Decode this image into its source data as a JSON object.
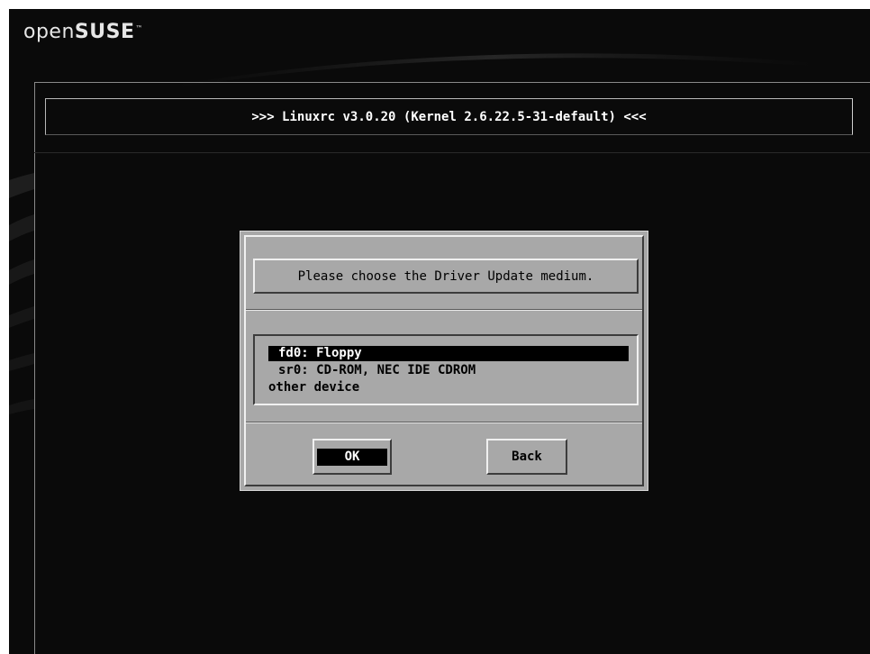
{
  "branding": {
    "logo_open": "open",
    "logo_suse": "SUSE",
    "logo_tm": "™"
  },
  "title_bar": {
    "text": ">>> Linuxrc v3.0.20 (Kernel 2.6.22.5-31-default) <<<"
  },
  "dialog": {
    "prompt": "Please choose the Driver Update medium.",
    "items": [
      {
        "label": "fd0: Floppy",
        "selected": true
      },
      {
        "label": "sr0: CD-ROM, NEC IDE CDROM",
        "selected": false
      },
      {
        "label": "other device",
        "selected": false
      }
    ],
    "buttons": {
      "ok": "OK",
      "back": "Back"
    }
  },
  "colors": {
    "screen_bg": "#0a0a0a",
    "dialog_bg": "#a8a8a8",
    "highlight_bg": "#000000",
    "highlight_text": "#ffffff"
  }
}
